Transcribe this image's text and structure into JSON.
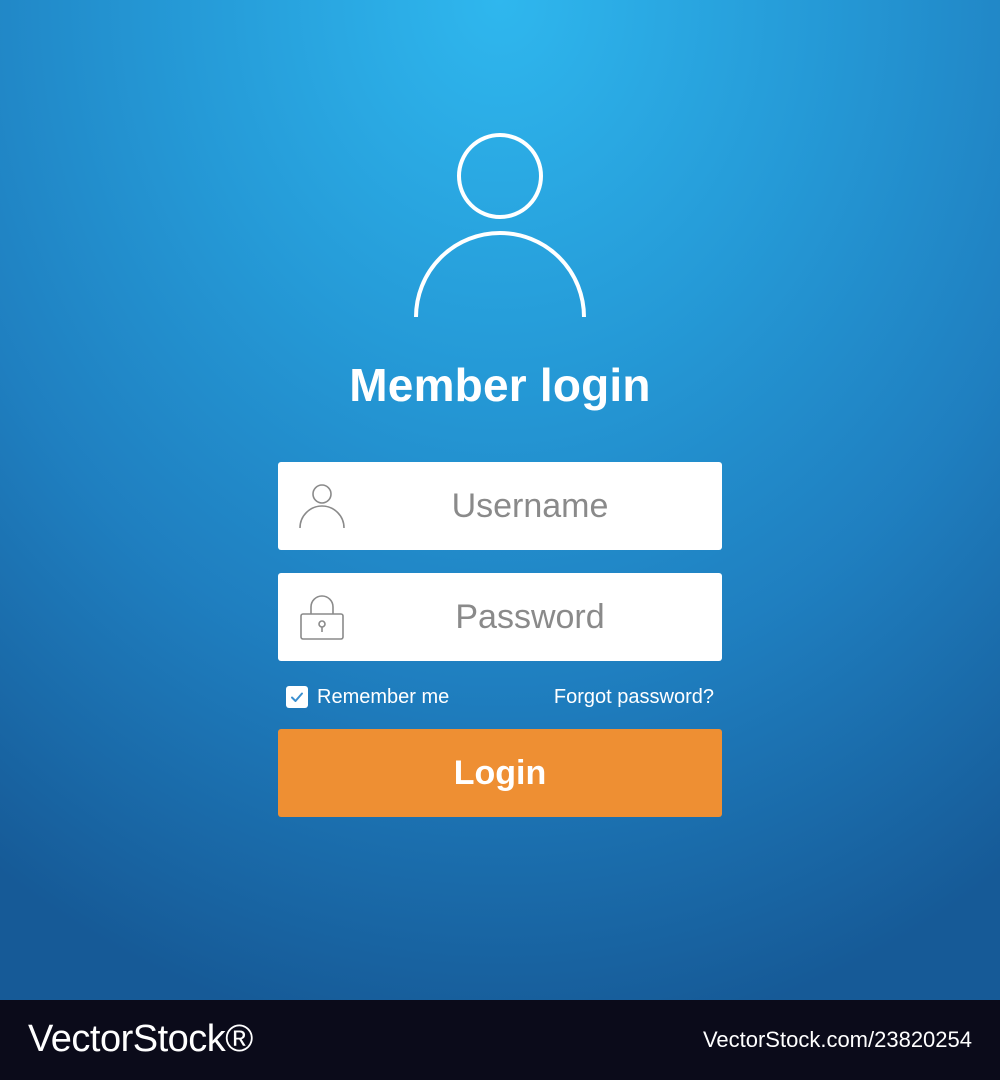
{
  "login_form": {
    "title": "Member login",
    "username": {
      "placeholder": "Username",
      "icon": "user-icon"
    },
    "password": {
      "placeholder": "Password",
      "icon": "padlock-icon"
    },
    "remember_me": {
      "label": "Remember me",
      "checked": true
    },
    "forgot_password_label": "Forgot password?",
    "login_button_label": "Login",
    "avatar_icon": "user-avatar-icon"
  },
  "footer": {
    "brand": "VectorStock®",
    "image_id": "VectorStock.com/23820254"
  },
  "colors": {
    "background_top": "#2fb7ee",
    "background_bottom": "#165a97",
    "login_button": "#ee8f33",
    "field_background": "#ffffff",
    "footer_background": "#0b0b1a"
  }
}
